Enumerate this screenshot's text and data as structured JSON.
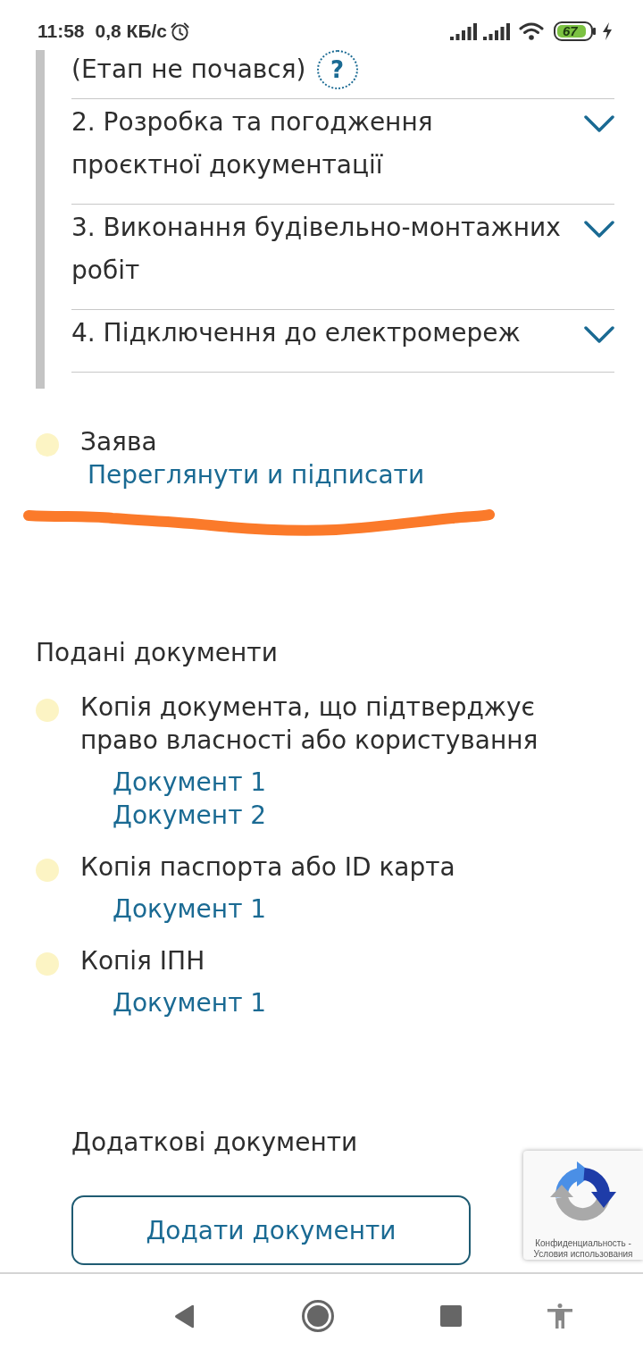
{
  "status_bar": {
    "time": "11:58",
    "network_speed": "0,8 КБ/с",
    "battery_percent": "67"
  },
  "stages": {
    "status_text": "(Етап не почався)",
    "help_button": "?",
    "items": [
      {
        "title": "2. Розробка та погодження проєктної документації",
        "expanded": false
      },
      {
        "title": "3. Виконання будівельно-монтажних робіт",
        "expanded": false
      },
      {
        "title": "4. Підключення до електромереж",
        "expanded": false
      }
    ]
  },
  "application": {
    "label": "Заява",
    "link": "Переглянути и підписати"
  },
  "submitted_documents": {
    "heading": "Подані документи",
    "items": [
      {
        "title": "Копія документа, що підтверджує право власності або користування",
        "files": [
          "Документ 1",
          "Документ 2"
        ]
      },
      {
        "title": "Копія паспорта або ID карта",
        "files": [
          "Документ 1"
        ]
      },
      {
        "title": "Копія ІПН",
        "files": [
          "Документ 1"
        ]
      }
    ]
  },
  "additional_documents": {
    "heading": "Додаткові документи",
    "button": "Додати документи"
  },
  "recaptcha": {
    "privacy_link": "Конфиденциальность",
    "separator": "-",
    "terms_link": "Условия использования"
  }
}
